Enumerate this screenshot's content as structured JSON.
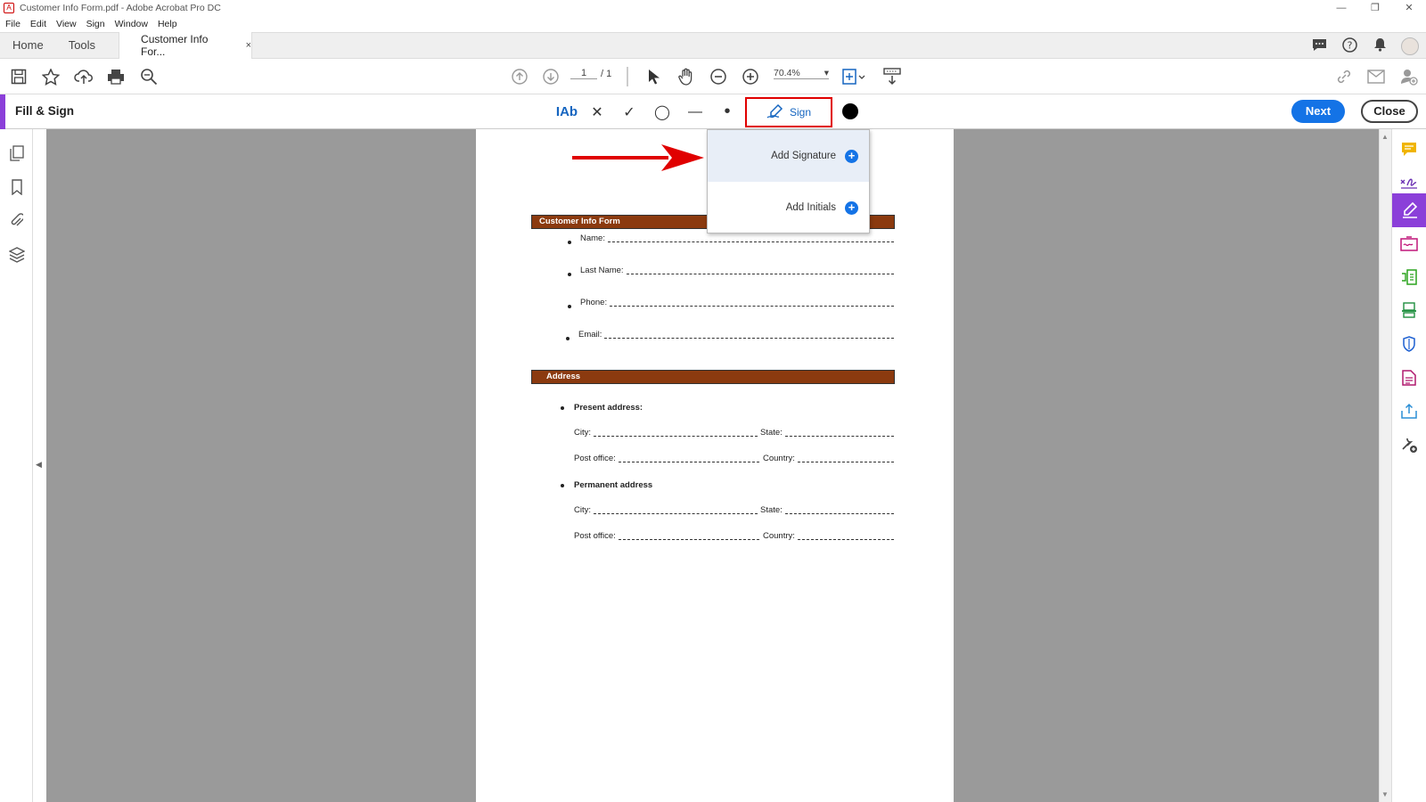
{
  "window": {
    "title": "Customer Info Form.pdf - Adobe Acrobat Pro DC",
    "controls": [
      "—",
      "❐",
      "✕"
    ]
  },
  "menu": [
    "File",
    "Edit",
    "View",
    "Sign",
    "Window",
    "Help"
  ],
  "tabs": {
    "home": "Home",
    "tools": "Tools",
    "document": "Customer Info For...",
    "close_symbol": "×"
  },
  "toolbar": {
    "page_current": "1",
    "page_total": "/ 1",
    "zoom": "70.4%"
  },
  "fill_sign": {
    "title": "Fill & Sign",
    "tools": {
      "text": "IAb",
      "cross": "✕",
      "check": "✓",
      "ellipse": "◯",
      "line": "—",
      "dot": "•"
    },
    "sign_label": "Sign",
    "color": "#000000",
    "next_label": "Next",
    "close_label": "Close"
  },
  "dropdown": {
    "add_signature": "Add Signature",
    "add_initials": "Add Initials",
    "plus": "+"
  },
  "form": {
    "section1_title": "Customer Info Form",
    "name_label": "Name:",
    "last_name_label": "Last Name:",
    "phone_label": "Phone:",
    "email_label": "Email:",
    "section2_title": "Address",
    "present_address": "Present address:",
    "permanent_address": "Permanent address",
    "city_label": "City:",
    "state_label": "State:",
    "post_office_label": "Post office:",
    "country_label": "Country:"
  },
  "colors": {
    "accent_purple": "#8b3fd9",
    "primary_blue": "#1473e6",
    "band_brown": "#8b3a0f",
    "highlight_red": "#e00000"
  }
}
